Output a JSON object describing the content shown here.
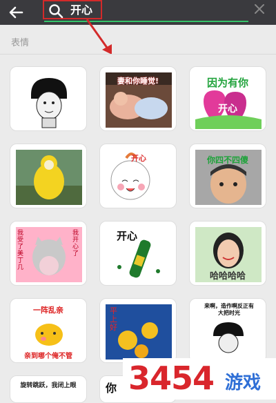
{
  "search": {
    "query": "开心"
  },
  "section": {
    "title": "表情"
  },
  "stickers": [
    {
      "id": "mushroom-face",
      "caption": ""
    },
    {
      "id": "sleeping-boys",
      "caption": "妻和你睡觉!"
    },
    {
      "id": "heart-happy",
      "caption_top": "因为有你",
      "caption_bottom": "开心"
    },
    {
      "id": "yellow-teletubby",
      "caption": ""
    },
    {
      "id": "baby-happy",
      "caption": "开心"
    },
    {
      "id": "kid-face",
      "caption": "你四不四傻"
    },
    {
      "id": "cat-sticker",
      "caption_left": "我受了美丁几",
      "caption_right": "我开心了"
    },
    {
      "id": "beer-bottle",
      "caption": "开心"
    },
    {
      "id": "girl-laughing",
      "caption": "哈哈哈哈"
    },
    {
      "id": "yellow-blob",
      "caption_top": "一阵乱亲",
      "caption_bottom": "亲到哪个俺不管"
    },
    {
      "id": "butterflies",
      "caption": "平上好"
    },
    {
      "id": "mushroom-comic",
      "caption": "来啊，造作啊反正有大把时光"
    },
    {
      "id": "partial-1",
      "caption": "旋转跳跃，我闭上眼"
    },
    {
      "id": "partial-2",
      "caption": "你"
    }
  ],
  "watermark": {
    "digits": "3454",
    "text": "游戏"
  },
  "colors": {
    "topbar": "#3a3a3e",
    "accent": "#35c56b",
    "highlight": "#d32a2a"
  }
}
